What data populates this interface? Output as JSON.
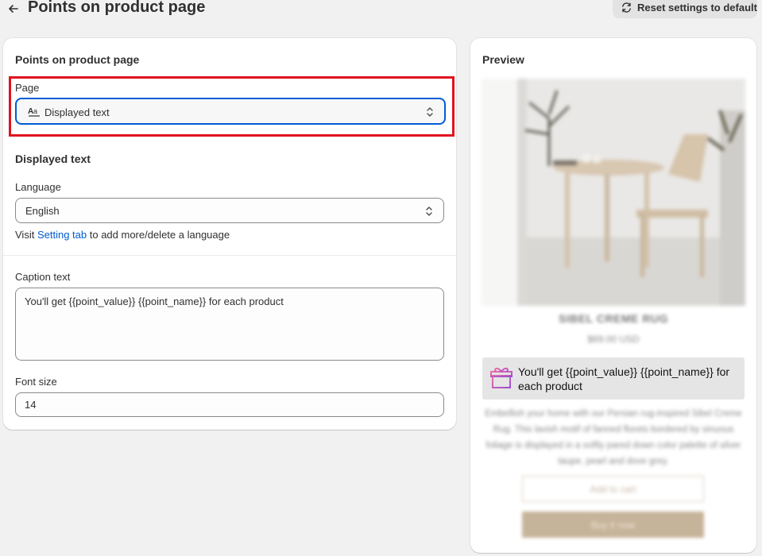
{
  "header": {
    "title": "Points on product page",
    "reset_label": "Reset settings to default"
  },
  "settings": {
    "heading": "Points on product page",
    "page_field": {
      "label": "Page",
      "value": "Displayed text"
    },
    "displayed_text": {
      "heading": "Displayed text",
      "language": {
        "label": "Language",
        "value": "English"
      },
      "helper_prefix": "Visit",
      "helper_link": "Setting tab",
      "helper_suffix": "to add more/delete a language"
    },
    "caption": {
      "label": "Caption text",
      "value": "You'll get {{point_value}} {{point_name}} for each product"
    },
    "font_size": {
      "label": "Font size",
      "value": "14"
    }
  },
  "preview": {
    "heading": "Preview",
    "product_title": "SIBEL CREME RUG",
    "product_price": "$69.00 USD",
    "points_text": "You'll get {{point_value}} {{point_name}} for each product",
    "description": "Embellish your home with our Persian rug-inspired Sibel Creme Rug. This lavish motif of fanned florets bordered by sinuous foliage is displayed in a softly pared down color palette of silver taupe, pearl and dove grey.",
    "add_to_cart_label": "Add to cart",
    "buy_now_label": "Buy it now"
  },
  "colors": {
    "accent_blue": "#005bd3",
    "highlight_red": "#e0141e",
    "buy_button": "#c6b49a",
    "gift_pink": "#d65ab4"
  },
  "icons": {
    "back": "arrow-left-icon",
    "reset": "refresh-icon",
    "page_select": "text-format-icon",
    "chevrons": "chevron-up-down-icon",
    "gift": "gift-icon"
  }
}
